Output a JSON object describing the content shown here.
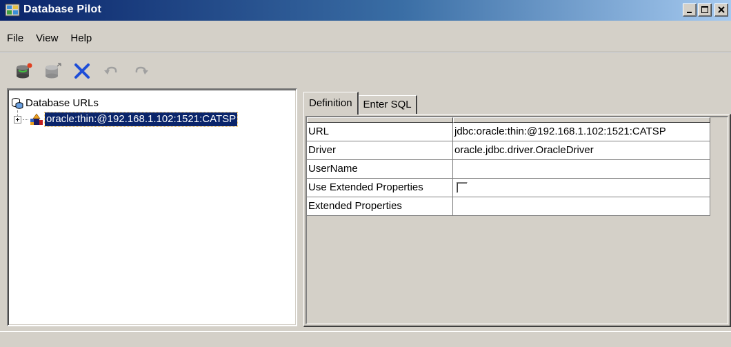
{
  "window": {
    "title": "Database Pilot",
    "buttons": [
      "minimize",
      "maximize",
      "close"
    ]
  },
  "menu": {
    "items": [
      "File",
      "View",
      "Help"
    ]
  },
  "toolbar": {
    "icons": [
      "new-connection-icon",
      "disconnect-icon",
      "delete-icon",
      "undo-icon",
      "redo-icon"
    ]
  },
  "tree": {
    "root_label": "Database URLs",
    "children": [
      {
        "label": "oracle:thin:@192.168.1.102:1521:CATSP",
        "selected": true
      }
    ]
  },
  "tabs": [
    {
      "label": "Definition",
      "active": true
    },
    {
      "label": "Enter SQL",
      "active": false
    }
  ],
  "properties": {
    "rows": [
      {
        "name": "URL",
        "value": "jdbc:oracle:thin:@192.168.1.102:1521:CATSP"
      },
      {
        "name": "Driver",
        "value": "oracle.jdbc.driver.OracleDriver"
      },
      {
        "name": "UserName",
        "value": ""
      },
      {
        "name": "Use Extended Properties",
        "value": "",
        "checkbox": false
      },
      {
        "name": "Extended Properties",
        "value": ""
      }
    ]
  },
  "colors": {
    "title_start": "#0a246a",
    "title_end": "#a6caf0",
    "selection": "#0a246a",
    "face": "#d4d0c8"
  }
}
